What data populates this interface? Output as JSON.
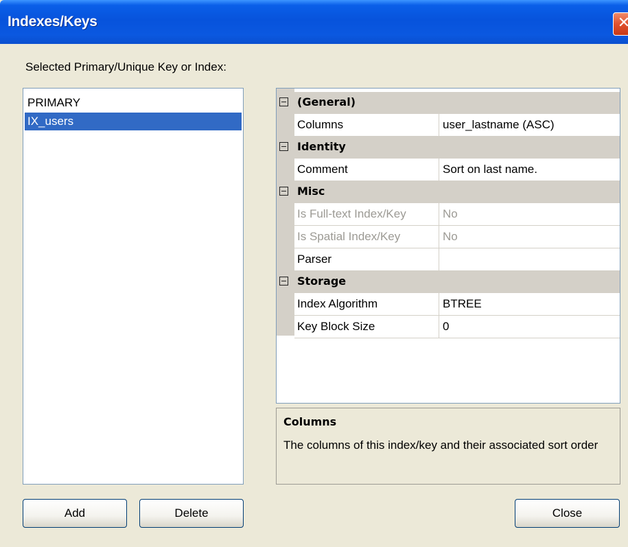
{
  "window": {
    "title": "Indexes/Keys",
    "close_glyph": "✕",
    "close_icon": "close-icon"
  },
  "prompt_label": "Selected Primary/Unique Key or Index:",
  "key_list": {
    "items": [
      {
        "label": "PRIMARY",
        "selected": false
      },
      {
        "label": "IX_users",
        "selected": true
      }
    ],
    "selection_color": "#316ac5"
  },
  "property_grid": {
    "categories": [
      {
        "name": "(General)",
        "expanded": true,
        "properties": [
          {
            "name": "Columns",
            "value": "user_lastname (ASC)",
            "enabled": true
          }
        ]
      },
      {
        "name": "Identity",
        "expanded": true,
        "properties": [
          {
            "name": "Comment",
            "value": "Sort on last name.",
            "enabled": true
          }
        ]
      },
      {
        "name": "Misc",
        "expanded": true,
        "properties": [
          {
            "name": "Is Full-text Index/Key",
            "value": "No",
            "enabled": false
          },
          {
            "name": "Is Spatial Index/Key",
            "value": "No",
            "enabled": false
          },
          {
            "name": "Parser",
            "value": "",
            "enabled": true
          }
        ]
      },
      {
        "name": "Storage",
        "expanded": true,
        "properties": [
          {
            "name": "Index Algorithm",
            "value": "BTREE",
            "enabled": true
          },
          {
            "name": "Key Block Size",
            "value": "0",
            "enabled": true
          }
        ]
      }
    ],
    "toggle_icon": "collapse-minus-icon"
  },
  "description": {
    "title": "Columns",
    "text": "The columns of this index/key and their associated sort order"
  },
  "buttons": {
    "add": "Add",
    "delete": "Delete",
    "close": "Close"
  },
  "colors": {
    "titlebar": "#0753dc",
    "dialog_bg": "#ece9d8",
    "category_bg": "#d4d0c8",
    "disabled_text": "#9c9a94"
  }
}
